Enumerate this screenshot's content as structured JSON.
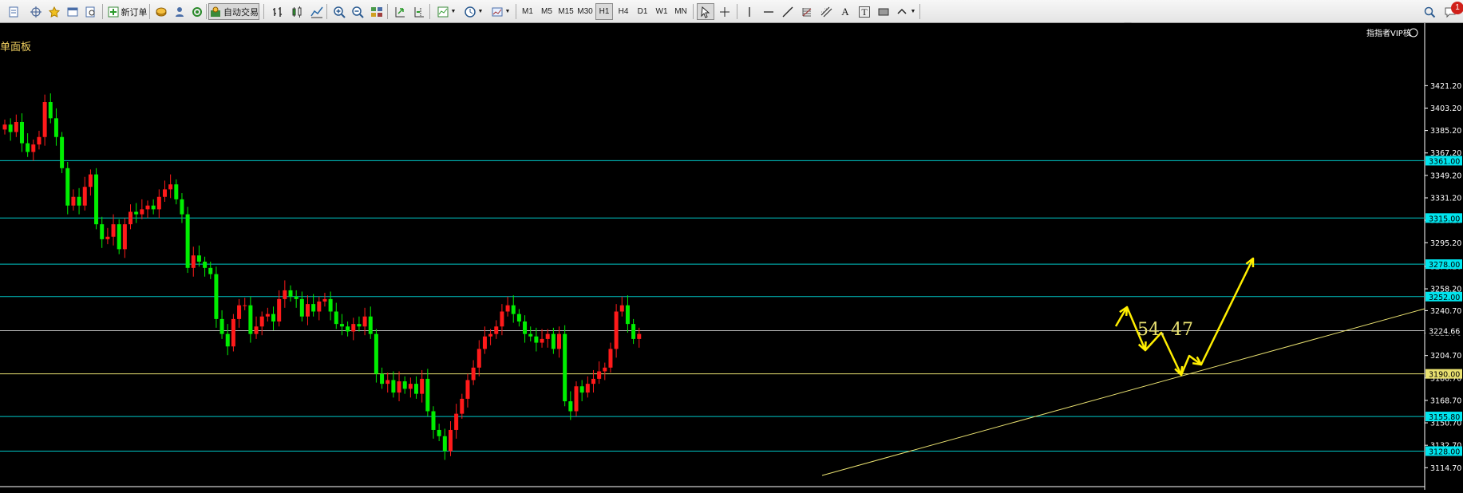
{
  "toolbar": {
    "new_order": "新订单",
    "auto_trading": "自动交易",
    "timeframes": [
      "M1",
      "M5",
      "M15",
      "M30",
      "H1",
      "H4",
      "D1",
      "W1",
      "MN"
    ],
    "active_timeframe": "H1",
    "text_tool": "A",
    "text_label_tool": "T",
    "notification_count": "1",
    "icons": [
      "new-chart-icon",
      "crosshair-icon",
      "favorites-icon",
      "templates-icon",
      "zoom-window-icon",
      "new-order-icon",
      "data-icon",
      "profile-icon",
      "signal-icon",
      "auto-trading-icon",
      "bar-chart-icon",
      "candlestick-icon",
      "line-chart-icon",
      "zoom-in-icon",
      "zoom-out-icon",
      "tile-windows-icon",
      "auto-scroll-icon",
      "chart-shift-icon",
      "indicators-icon",
      "periods-icon",
      "templates-menu-icon",
      "cursor-icon",
      "crosshair-tool-icon",
      "vertical-line-icon",
      "horizontal-line-icon",
      "trendline-icon",
      "fibonacci-icon",
      "channel-icon",
      "text-icon",
      "text-label-icon",
      "rectangle-icon",
      "arrows-icon",
      "search-icon",
      "chat-icon"
    ]
  },
  "chart": {
    "panel_title": "单面板",
    "vip_label": "指指者VIP核",
    "annotation": "54. 47",
    "up_color": "#ff1a1a",
    "down_color": "#00ee00",
    "grid_color": "#00c8c8",
    "support_color": "#e8e070",
    "arrow_color": "#ffee00",
    "label_color": "#00e5ee"
  },
  "chart_data": {
    "type": "candlestick",
    "ylim": [
      3114.7,
      3425
    ],
    "price_ticks": [
      "3421.20",
      "3403.20",
      "3385.20",
      "3367.20",
      "3349.20",
      "3331.20",
      "3313.20",
      "3295.20",
      "3276.20",
      "3258.20",
      "3240.70",
      "3222.70",
      "3204.70",
      "3186.70",
      "3168.70",
      "3150.70",
      "3132.70",
      "3114.70"
    ],
    "horizontal_levels": [
      {
        "label": "3361.00",
        "value": 3361.0,
        "type": "cyan"
      },
      {
        "label": "3315.00",
        "value": 3315.0,
        "type": "cyan"
      },
      {
        "label": "3278.00",
        "value": 3278.0,
        "type": "cyan"
      },
      {
        "label": "3252.00",
        "value": 3252.0,
        "type": "cyan"
      },
      {
        "label": "3224.66",
        "value": 3224.66,
        "type": "current"
      },
      {
        "label": "3190.00",
        "value": 3190.0,
        "type": "yellow"
      },
      {
        "label": "3155.80",
        "value": 3155.8,
        "type": "cyan"
      },
      {
        "label": "3128.00",
        "value": 3128.0,
        "type": "cyan"
      }
    ],
    "closes": [
      3390,
      3384,
      3392,
      3375,
      3368,
      3374,
      3380,
      3408,
      3395,
      3380,
      3355,
      3325,
      3332,
      3325,
      3340,
      3350,
      3310,
      3298,
      3300,
      3310,
      3290,
      3310,
      3320,
      3318,
      3322,
      3325,
      3322,
      3332,
      3338,
      3342,
      3330,
      3318,
      3275,
      3285,
      3280,
      3275,
      3270,
      3234,
      3222,
      3212,
      3234,
      3245,
      3245,
      3222,
      3228,
      3236,
      3238,
      3232,
      3250,
      3257,
      3252,
      3250,
      3236,
      3246,
      3240,
      3248,
      3250,
      3240,
      3230,
      3228,
      3224,
      3230,
      3228,
      3236,
      3222,
      3190,
      3182,
      3185,
      3175,
      3184,
      3178,
      3182,
      3174,
      3186,
      3160,
      3145,
      3140,
      3128,
      3145,
      3158,
      3170,
      3185,
      3195,
      3210,
      3220,
      3222,
      3228,
      3240,
      3245,
      3238,
      3232,
      3222,
      3220,
      3215,
      3218,
      3222,
      3210,
      3222,
      3168,
      3160,
      3180,
      3175,
      3182,
      3186,
      3192,
      3195,
      3210,
      3240,
      3245,
      3230,
      3218,
      3222
    ]
  }
}
